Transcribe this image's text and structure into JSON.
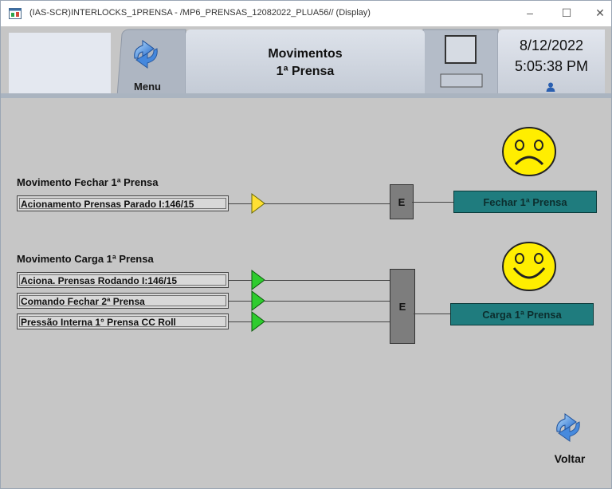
{
  "window": {
    "title": "(IAS-SCR)INTERLOCKS_1PRENSA - /MP6_PRENSAS_12082022_PLUA56// (Display)",
    "minimize": "–",
    "maximize": "☐",
    "close": "✕"
  },
  "header": {
    "menu_label": "Menu",
    "title_line1": "Movimentos",
    "title_line2": "1ª Prensa",
    "date": "8/12/2022",
    "time": "5:05:38 PM"
  },
  "group1": {
    "title": "Movimento Fechar 1ª Prensa",
    "inputs": [
      "Acionamento Prensas Parado I:146/15"
    ],
    "input_status": [
      "yellow"
    ],
    "gate_label": "E",
    "output_label": "Fechar 1ª Prensa",
    "smiley": "sad"
  },
  "group2": {
    "title": "Movimento Carga 1ª Prensa",
    "inputs": [
      "Aciona. Prensas Rodando I:146/15",
      "Comando Fechar 2ª Prensa",
      "Pressão Interna 1° Prensa CC Roll"
    ],
    "input_status": [
      "green",
      "green",
      "green"
    ],
    "gate_label": "E",
    "output_label": "Carga 1ª Prensa",
    "smiley": "happy"
  },
  "footer": {
    "back_label": "Voltar"
  },
  "colors": {
    "background": "#c6c6c6",
    "output_box": "#1f7c7e",
    "gate_box": "#7d7d7d",
    "triangle_yellow": "#ffe033",
    "triangle_green": "#2ecc2e",
    "smiley_face": "#ffee00"
  },
  "icons": {
    "menu": "menu-arrow-icon",
    "back": "back-arrow-icon",
    "user": "user-icon"
  }
}
